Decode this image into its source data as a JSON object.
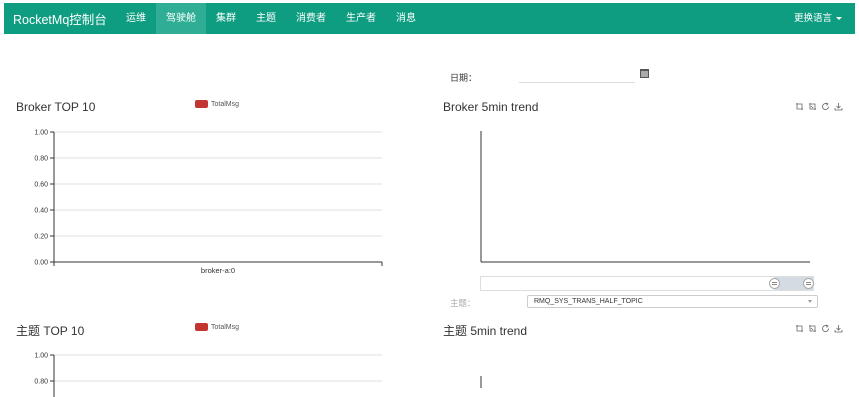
{
  "nav": {
    "brand": "RocketMq控制台",
    "items": [
      {
        "label": "运维"
      },
      {
        "label": "驾驶舱",
        "active": true
      },
      {
        "label": "集群"
      },
      {
        "label": "主题"
      },
      {
        "label": "消费者"
      },
      {
        "label": "生产者"
      },
      {
        "label": "消息"
      }
    ],
    "language": "更换语言"
  },
  "date_filter": {
    "label": "日期：",
    "value": ""
  },
  "colors": {
    "navbar": "#0f9d82",
    "active_tab": "#2fae95",
    "series": "#c23531"
  },
  "broker_top10": {
    "title": "Broker TOP 10",
    "legend": "TotalMsg"
  },
  "broker_trend": {
    "title": "Broker 5min trend"
  },
  "topic_selector": {
    "label": "主题：",
    "selected": "RMQ_SYS_TRANS_HALF_TOPIC"
  },
  "topic_top10": {
    "title": "主题 TOP 10",
    "legend": "TotalMsg"
  },
  "topic_trend": {
    "title": "主题 5min trend"
  },
  "toolbox_icons": [
    "zoom-icon",
    "zoom-reset-icon",
    "restore-icon",
    "download-icon"
  ],
  "chart_data": [
    {
      "type": "bar",
      "title": "Broker TOP 10",
      "categories": [
        "broker-a:0"
      ],
      "series": [
        {
          "name": "TotalMsg",
          "values": [
            0
          ]
        }
      ],
      "ylim": [
        0,
        1
      ],
      "yticks": [
        "1.00",
        "0.80",
        "0.60",
        "0.40",
        "0.20",
        "0.00"
      ],
      "grid": true,
      "legend": "top-center"
    },
    {
      "type": "bar",
      "title": "主题 TOP 10",
      "categories": [],
      "series": [
        {
          "name": "TotalMsg",
          "values": []
        }
      ],
      "ylim": [
        0,
        1
      ],
      "yticks": [
        "1.00",
        "0.80"
      ],
      "grid": true,
      "legend": "top-center"
    },
    {
      "type": "line",
      "title": "Broker 5min trend",
      "series": []
    },
    {
      "type": "line",
      "title": "主题 5min trend",
      "series": []
    }
  ]
}
